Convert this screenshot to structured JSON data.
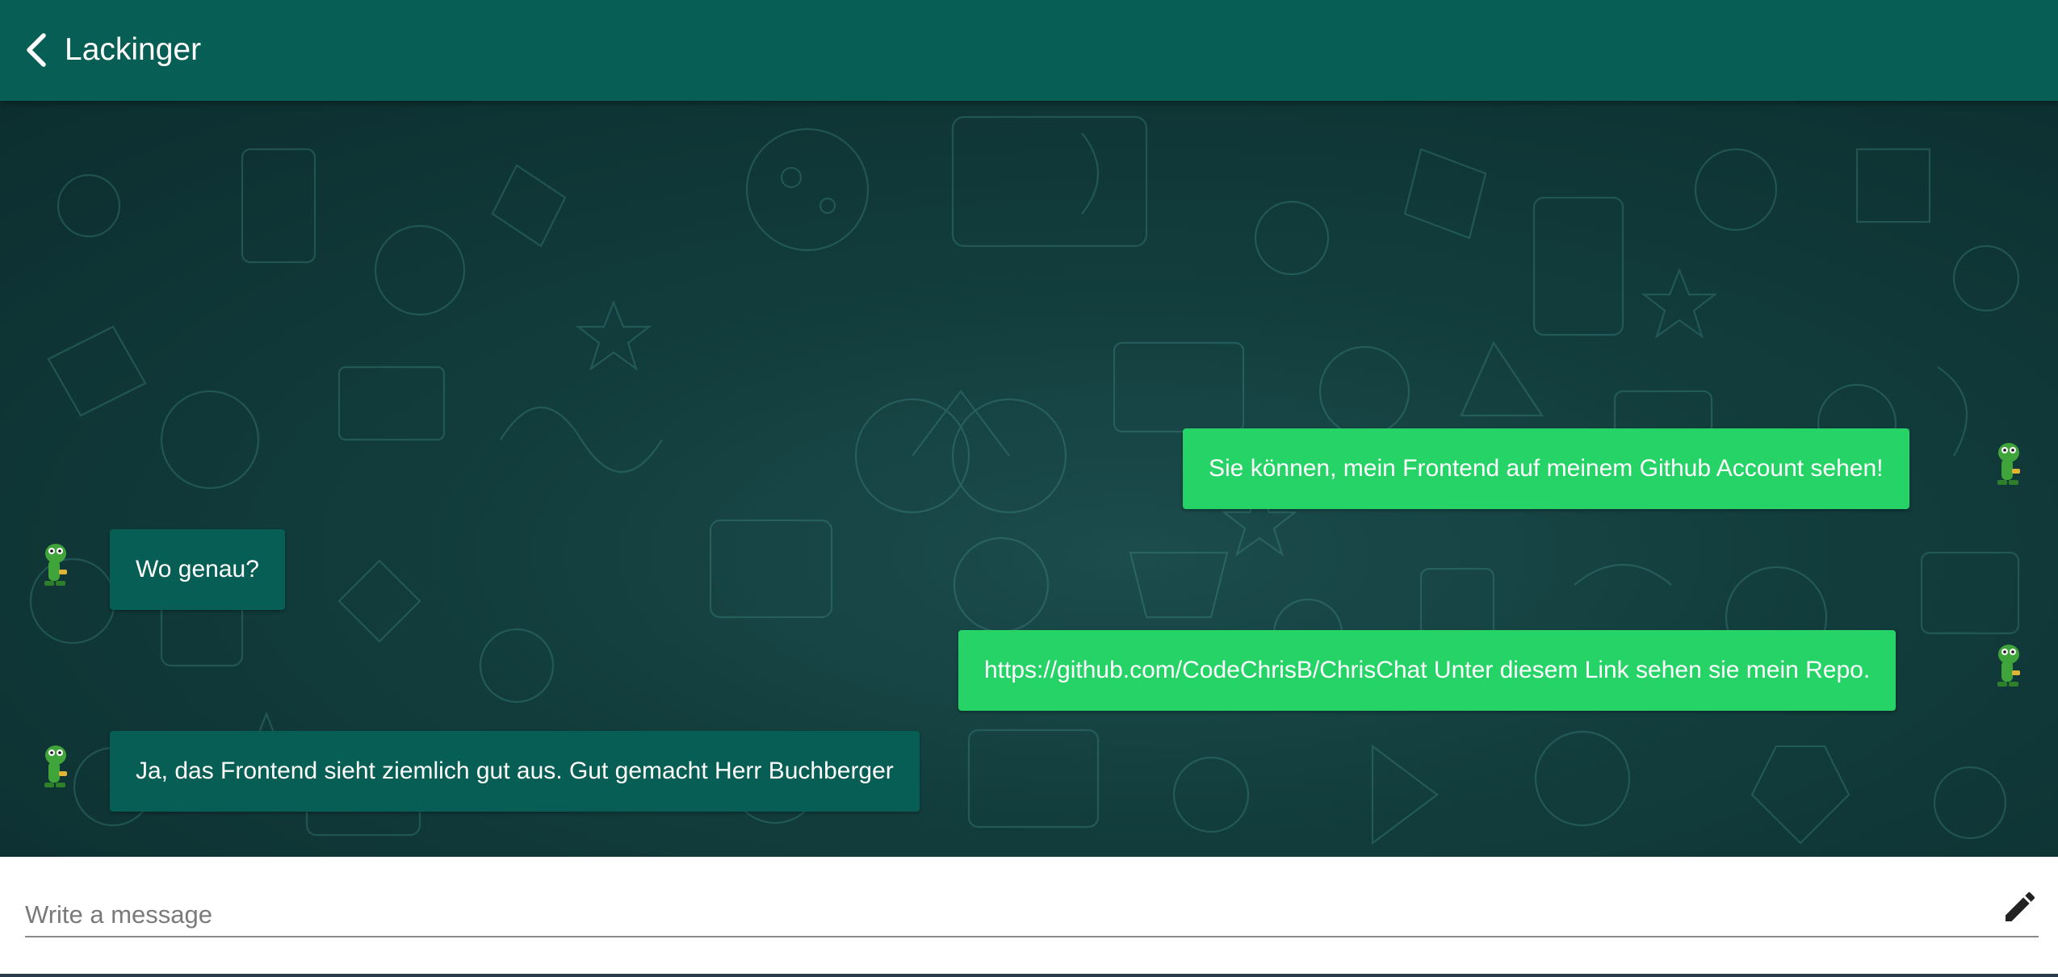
{
  "header": {
    "title": "Lackinger",
    "back_icon": "chevron-left-icon"
  },
  "colors": {
    "header_bg": "#075e54",
    "sent_bubble": "#25d366",
    "received_bubble": "#075e54",
    "chat_bg": "#123c3c"
  },
  "messages": [
    {
      "direction": "sent",
      "text": "Sie können, mein Frontend auf meinem Github Account sehen!"
    },
    {
      "direction": "received",
      "text": "Wo genau?"
    },
    {
      "direction": "sent",
      "text": "https://github.com/CodeChrisB/ChrisChat Unter diesem Link sehen sie mein Repo."
    },
    {
      "direction": "received",
      "text": "Ja, das Frontend sieht ziemlich gut aus. Gut gemacht Herr Buchberger"
    }
  ],
  "compose": {
    "placeholder": "Write a message",
    "value": "",
    "send_icon": "pencil-icon"
  }
}
